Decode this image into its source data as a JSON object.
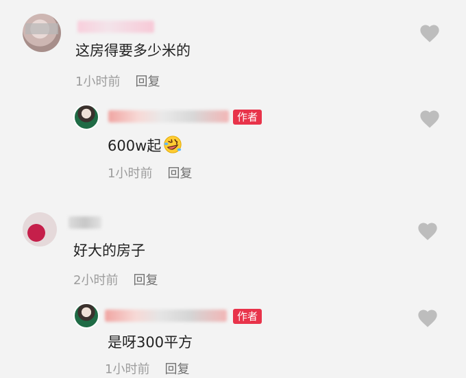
{
  "comments": [
    {
      "text": "这房得要多少米的",
      "time": "1小时前",
      "reply_label": "回复",
      "avatar_color": "#cdb6b2",
      "name_blurred": true,
      "reply": {
        "badge": "作者",
        "text": "600w起",
        "emoji": "rofl-emoji",
        "time": "1小时前",
        "reply_label": "回复",
        "name_blurred": true
      }
    },
    {
      "text": "好大的房子",
      "time": "2小时前",
      "reply_label": "回复",
      "avatar_color": "#c51f4a",
      "name_blurred": true,
      "reply": {
        "badge": "作者",
        "text": "是呀300平方",
        "time": "1小时前",
        "reply_label": "回复",
        "name_blurred": true
      }
    }
  ],
  "colors": {
    "background": "#f3f3f3",
    "badge": "#e8334a",
    "meta_text": "#9c9c9c",
    "like_icon": "#bdbdbd"
  }
}
